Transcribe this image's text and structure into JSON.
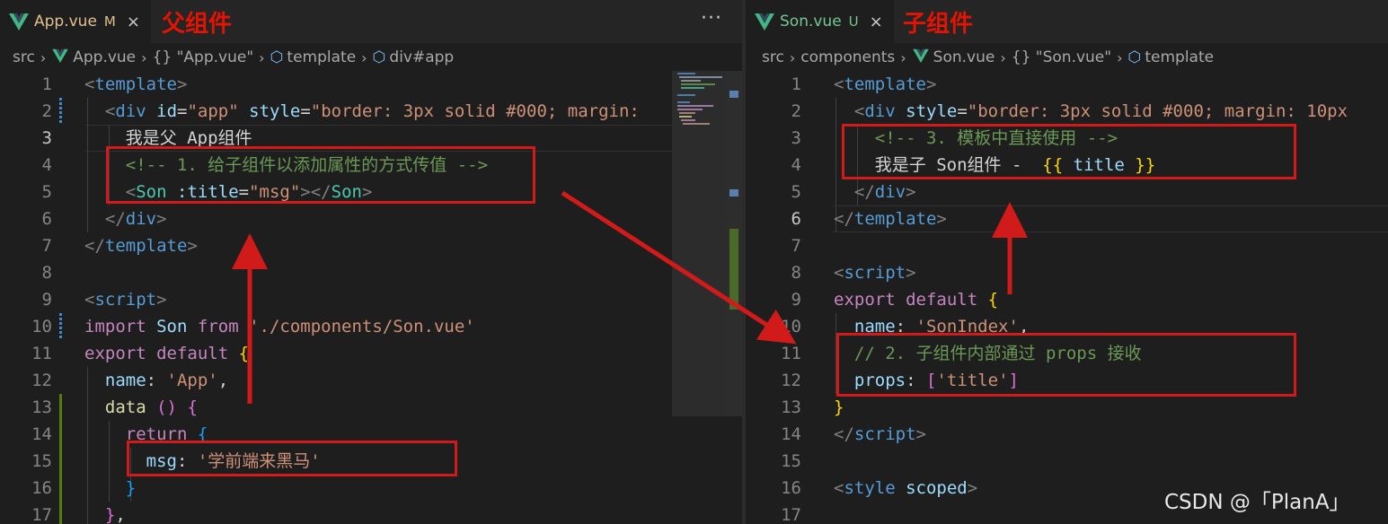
{
  "left": {
    "tab": {
      "name": "App.vue",
      "flag": "M",
      "close": "×"
    },
    "annotation": "父组件",
    "more": "···",
    "breadcrumb": [
      "src",
      "App.vue",
      "{} \"App.vue\"",
      "template",
      "div#app"
    ],
    "lines": [
      {
        "n": "1"
      },
      {
        "n": "2"
      },
      {
        "n": "3"
      },
      {
        "n": "4"
      },
      {
        "n": "5"
      },
      {
        "n": "6"
      },
      {
        "n": "7"
      },
      {
        "n": "8"
      },
      {
        "n": "9"
      },
      {
        "n": "10"
      },
      {
        "n": "11"
      },
      {
        "n": "12"
      },
      {
        "n": "13"
      },
      {
        "n": "14"
      },
      {
        "n": "15"
      },
      {
        "n": "16"
      },
      {
        "n": "17"
      }
    ],
    "code": {
      "l2": {
        "id_attr": "id",
        "id_val": "\"app\"",
        "style_attr": "style",
        "style_val": "\"border: 3px solid #000; margin:"
      },
      "l3": "我是父 App组件",
      "l4": "<!-- 1. 给子组件以添加属性的方式传值 -->",
      "l5": {
        "prop": ":title",
        "val": "\"msg\""
      },
      "l10": {
        "path": "'./components/Son.vue'"
      },
      "l12": {
        "key": "name",
        "val": "'App'"
      },
      "l15": {
        "key": "msg",
        "val": "'学前端来黑马'"
      }
    }
  },
  "right": {
    "tab": {
      "name": "Son.vue",
      "flag": "U",
      "close": "×"
    },
    "annotation": "子组件",
    "breadcrumb": [
      "src",
      "components",
      "Son.vue",
      "{} \"Son.vue\"",
      "template"
    ],
    "lines": [
      {
        "n": "1"
      },
      {
        "n": "2"
      },
      {
        "n": "3"
      },
      {
        "n": "4"
      },
      {
        "n": "5"
      },
      {
        "n": "6"
      },
      {
        "n": "7"
      },
      {
        "n": "8"
      },
      {
        "n": "9"
      },
      {
        "n": "10"
      },
      {
        "n": "11"
      },
      {
        "n": "12"
      },
      {
        "n": "13"
      },
      {
        "n": "14"
      },
      {
        "n": "15"
      },
      {
        "n": "16"
      },
      {
        "n": "17"
      }
    ],
    "code": {
      "l2": {
        "style_attr": "style",
        "style_val": "\"border: 3px solid #000; margin: 10px"
      },
      "l3": "<!-- 3. 模板中直接使用 -->",
      "l4": {
        "text": "我是子 Son组件 - ",
        "mustache": "title"
      },
      "l10": {
        "key": "name",
        "val": "'SonIndex'"
      },
      "l11": "// 2. 子组件内部通过 props 接收",
      "l12": {
        "key": "props",
        "val": "'title'"
      }
    }
  },
  "watermark": "CSDN @「PlanA」",
  "colors": {
    "annotation": "#e51400",
    "highlight_box": "#d11a1a",
    "modified_tab": "#e2c08d",
    "background": "#1e1e1e"
  }
}
